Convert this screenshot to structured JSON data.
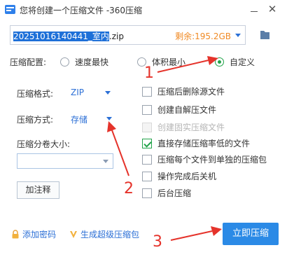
{
  "window": {
    "title": "您将创建一个压缩文件 -360压缩",
    "close_glyph": "✕"
  },
  "path": {
    "filename_selected": "20251016140441_室内",
    "filename_ext": ".zip",
    "free_space": "剩余:195.2GB"
  },
  "config": {
    "label": "压缩配置:",
    "options": [
      "速度最快",
      "体积最小",
      "自定义"
    ],
    "selected": "自定义"
  },
  "format": {
    "label": "压缩格式:",
    "value": "ZIP"
  },
  "method": {
    "label": "压缩方式:",
    "value": "存储"
  },
  "volume": {
    "label": "压缩分卷大小:",
    "value": ""
  },
  "buttons": {
    "add_comment": "加注释",
    "compress_now": "立即压缩"
  },
  "options": [
    {
      "label": "压缩后删除源文件",
      "checked": false,
      "disabled": false
    },
    {
      "label": "创建自解压文件",
      "checked": false,
      "disabled": false
    },
    {
      "label": "创建固实压缩文件",
      "checked": false,
      "disabled": true
    },
    {
      "label": "直接存储压缩率低的文件",
      "checked": true,
      "disabled": false
    },
    {
      "label": "压缩每个文件到单独的压缩包",
      "checked": false,
      "disabled": false
    },
    {
      "label": "操作完成后关机",
      "checked": false,
      "disabled": false
    },
    {
      "label": "后台压缩",
      "checked": false,
      "disabled": false
    }
  ],
  "links": {
    "add_password": "添加密码",
    "super_compress": "生成超级压缩包"
  },
  "annotations": [
    "1",
    "2",
    "3"
  ],
  "colors": {
    "accent_blue": "#2b6fd6",
    "button_blue": "#2b8ae6",
    "space_orange": "#f08a24",
    "check_green": "#22a34a",
    "annotation_red": "#e5332b"
  }
}
